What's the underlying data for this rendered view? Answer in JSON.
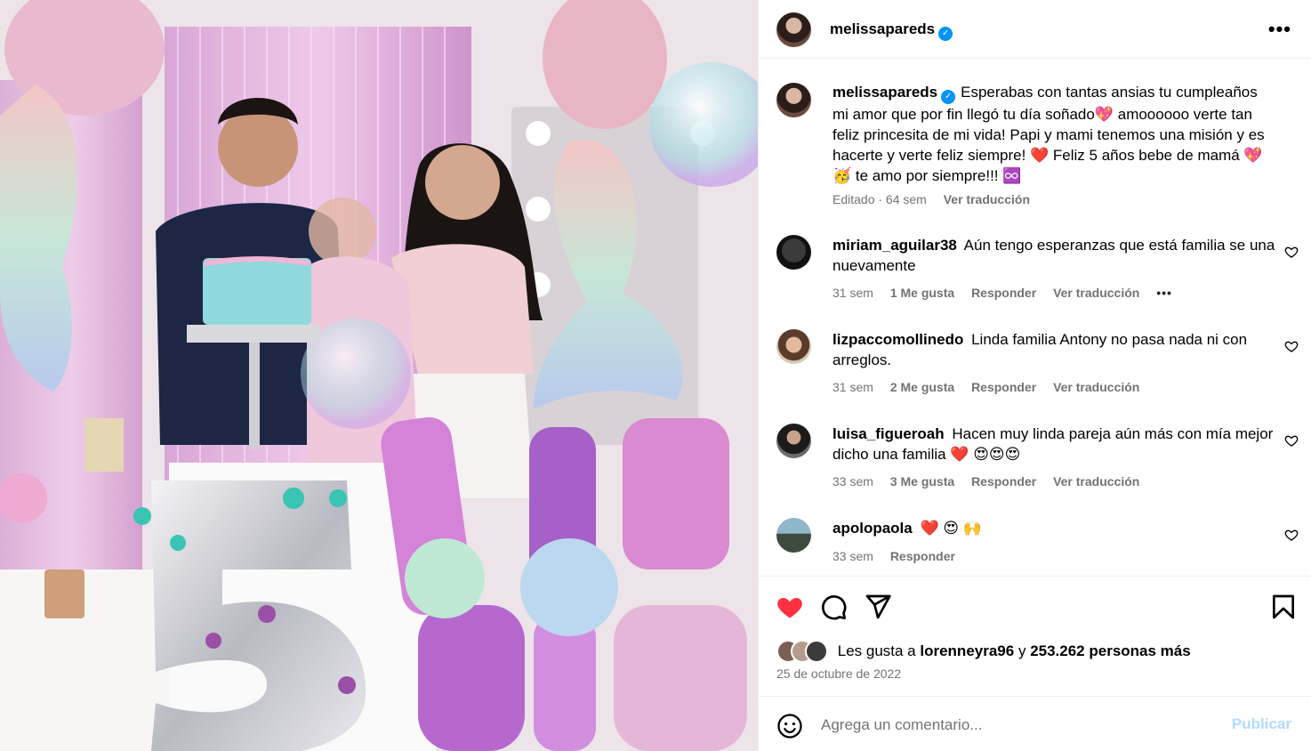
{
  "post": {
    "username": "melissapareds",
    "verified": true
  },
  "caption": {
    "username": "melissapareds",
    "text": "Esperabas con tantas ansias tu cumpleaños mi amor que por fin llegó tu día soñado💖 amoooooo verte tan feliz princesita de mi vida! Papi y mami tenemos una misión y es hacerte y verte feliz siempre! ❤️ Feliz 5 años bebe de mamá 💖 🥳 te amo por siempre!!! ♾️",
    "edited": "Editado · 64 sem",
    "translate": "Ver traducción"
  },
  "comments": [
    {
      "username": "miriam_aguilar38",
      "text": "Aún tengo esperanzas que está familia se una nuevamente",
      "time": "31 sem",
      "likes": "1 Me gusta",
      "reply": "Responder",
      "translate": "Ver traducción",
      "more": "•••"
    },
    {
      "username": "lizpaccomollinedo",
      "text": "Linda familia Antony no pasa nada ni con arreglos.",
      "time": "31 sem",
      "likes": "2 Me gusta",
      "reply": "Responder",
      "translate": "Ver traducción"
    },
    {
      "username": "luisa_figueroah",
      "text": "Hacen muy linda pareja aún más con mía mejor dicho una familia ❤️ 😍😍😍",
      "time": "33 sem",
      "likes": "3 Me gusta",
      "reply": "Responder",
      "translate": "Ver traducción"
    },
    {
      "username": "apolopaola",
      "text": "❤️ 😍 🙌",
      "time": "33 sem",
      "reply": "Responder"
    }
  ],
  "likes": {
    "prefix": "Les gusta a",
    "user": "lorenneyra96",
    "middle": "y",
    "others": "253.262 personas más"
  },
  "date": "25 de octubre de 2022",
  "composer": {
    "placeholder": "Agrega un comentario...",
    "post_label": "Publicar"
  },
  "colors": {
    "like_red": "#ff3040",
    "verified_blue": "#0095f6",
    "post_disabled": "#b3dbff",
    "meta_gray": "#737373"
  },
  "icons": [
    "more-icon",
    "verified-icon",
    "heart-icon",
    "comment-icon",
    "share-icon",
    "bookmark-icon",
    "emoji-icon"
  ]
}
